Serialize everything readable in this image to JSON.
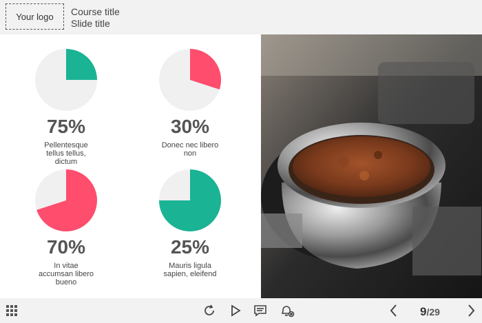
{
  "header": {
    "logo": "Your logo",
    "course_title": "Course title",
    "slide_title": "Slide title"
  },
  "stats": [
    {
      "percent": "75%",
      "caption": [
        "Pellentesque",
        "tellus tellus,",
        "dictum"
      ],
      "fraction": 0.25,
      "color": "#1ab394"
    },
    {
      "percent": "30%",
      "caption": [
        "Donec nec libero",
        "non"
      ],
      "fraction": 0.3,
      "color": "#ff4d6d"
    },
    {
      "percent": "70%",
      "caption": [
        "In vitae",
        "accumsan libero",
        "bueno"
      ],
      "fraction": 0.7,
      "color": "#ff4d6d"
    },
    {
      "percent": "25%",
      "caption": [
        "Mauris ligula",
        "sapien, eleifend"
      ],
      "fraction": 0.75,
      "color": "#1ab394"
    }
  ],
  "footer": {
    "current_page": "9",
    "total_pages": "/29"
  },
  "icons": [
    "grid-menu-icon",
    "replay-icon",
    "play-icon",
    "notes-icon",
    "notifications-off-icon",
    "chevron-left-icon",
    "chevron-right-icon"
  ]
}
